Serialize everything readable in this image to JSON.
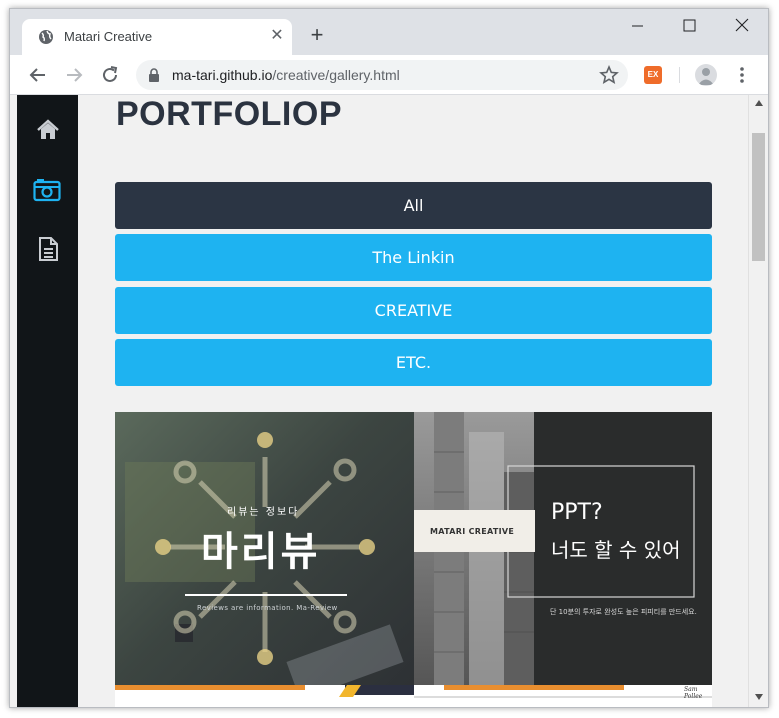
{
  "browser": {
    "tab_title": "Matari Creative",
    "url_host": "ma-tari.github.io",
    "url_path": "/creative/gallery.html",
    "extension_label": "EX"
  },
  "sidebar": {
    "items": [
      {
        "name": "home",
        "icon": "home-icon",
        "active": false
      },
      {
        "name": "gallery",
        "icon": "camera-icon",
        "active": true
      },
      {
        "name": "document",
        "icon": "document-icon",
        "active": false
      }
    ]
  },
  "page": {
    "title": "PORTFOLIOP"
  },
  "filters": [
    {
      "label": "All",
      "active": true
    },
    {
      "label": "The Linkin",
      "active": false
    },
    {
      "label": "CREATIVE",
      "active": false
    },
    {
      "label": "ETC.",
      "active": false
    }
  ],
  "gallery": {
    "items": [
      {
        "subtitle": "리뷰는 정보다",
        "title": "마리뷰",
        "caption": "Reviews are information. Ma-Review"
      },
      {
        "brand": "MATARI CREATIVE",
        "headline": "PPT?",
        "headline2": "너도 할 수 있어",
        "caption": "단 10분의 투자로 완성도 높은 피피티를 만드세요.",
        "signature": "Sam Pollee"
      }
    ]
  },
  "colors": {
    "sidebar_bg": "#111518",
    "active_filter": "#2b3544",
    "filter": "#1eb3f1",
    "accent_icon": "#1eb3f1"
  }
}
